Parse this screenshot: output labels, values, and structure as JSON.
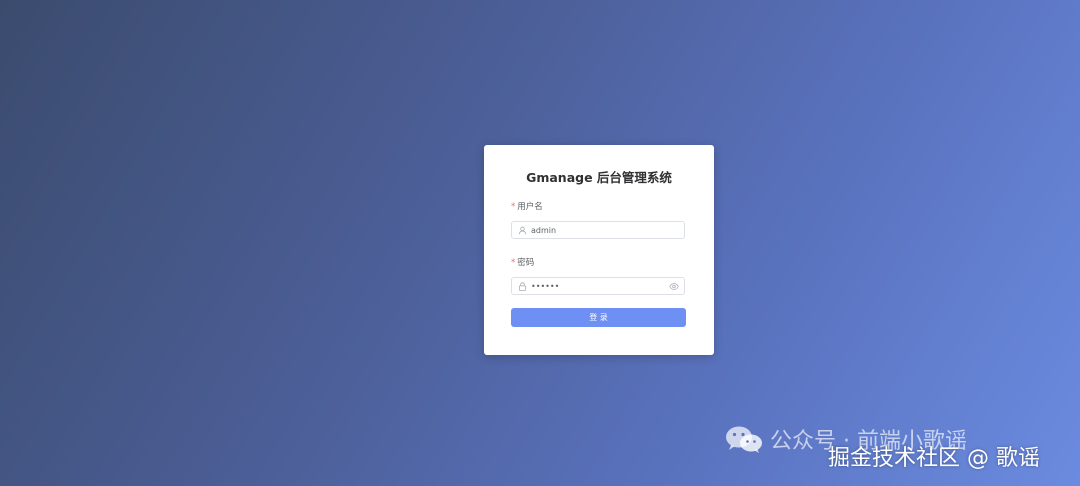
{
  "login": {
    "title": "Gmanage 后台管理系统",
    "username": {
      "required_mark": "*",
      "label": "用户名",
      "value": "admin"
    },
    "password": {
      "required_mark": "*",
      "label": "密码",
      "value": "••••••"
    },
    "submit_label": "登 录"
  },
  "watermarks": {
    "wechat_text": "公众号 · 前端小歌谣",
    "juejin_text": "掘金技术社区 @ 歌谣"
  },
  "colors": {
    "primary_button": "#6e90f5",
    "required_star": "#f56c6c",
    "background_start": "#3b4b6e",
    "background_end": "#6b8be0"
  },
  "icons": {
    "username_field": "user-icon",
    "password_field": "lock-icon",
    "password_toggle": "eye-icon",
    "watermark_logo": "wechat-icon"
  }
}
